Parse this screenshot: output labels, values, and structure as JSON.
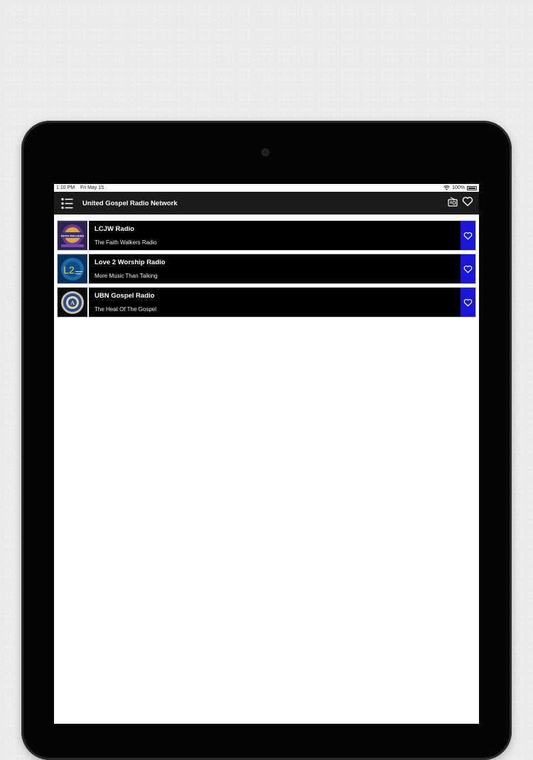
{
  "status_bar": {
    "time": "1:10 PM",
    "date": "Fri May 15",
    "battery": "100%"
  },
  "header": {
    "title": "United Gospel Radio Network",
    "menu_icon": "list-icon",
    "radio_icon": "radio-icon",
    "favorites_icon": "heart-icon"
  },
  "stations": [
    {
      "name": "LCJW Radio",
      "tagline": "The Faith Walkers Radio",
      "logo_text": "FAITH WALKERS"
    },
    {
      "name": "Love 2 Worship Radio",
      "tagline": "More Music Than Talking",
      "logo_text": "L2"
    },
    {
      "name": "UBN Gospel Radio",
      "tagline": "The Heat Of The Gospel",
      "logo_text": "A"
    }
  ],
  "colors": {
    "nav_bg": "#1b1b1b",
    "row_bg": "#000000",
    "favorite_button": "#1b17d8"
  }
}
